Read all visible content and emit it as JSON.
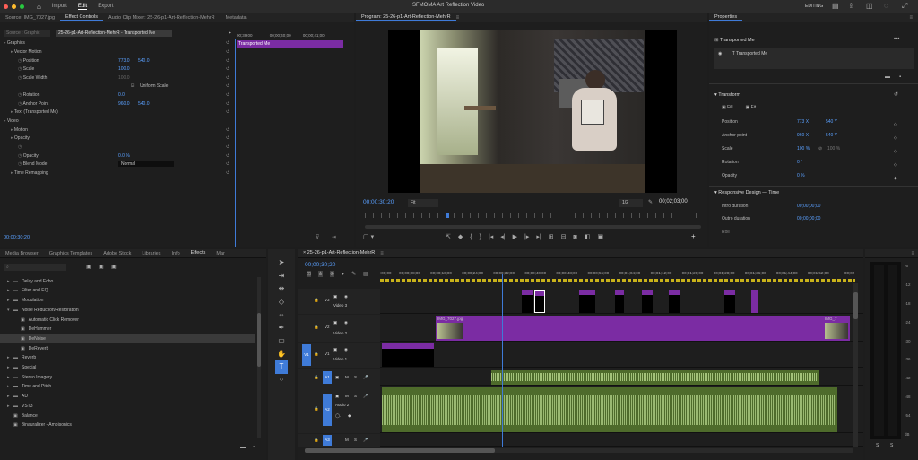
{
  "titlebar": {
    "home_label": "⌂",
    "tabs": [
      "Import",
      "Edit",
      "Export"
    ],
    "active_tab": "Edit",
    "title": "SFMOMA Art Reflection Video",
    "workspace": "EDITING"
  },
  "source_panel": {
    "tabs": [
      "Source: IMG_7027.jpg",
      "Effect Controls",
      "Audio Clip Mixer: 25-26-p1-Art-Reflection-MehrR",
      "Metadata"
    ],
    "active_tab": "Effect Controls",
    "source_select_left": "Source : Graphic",
    "source_select_right": "25-26-p1-Art-Reflection-MehrR - Transported Me",
    "ruler_labels": [
      "00;39;00",
      "00;00;40;00",
      "00;00;41;00"
    ],
    "clip_label": "Transported Me",
    "rows": [
      {
        "label": "Graphics",
        "indent": 0,
        "value": "",
        "value2": ""
      },
      {
        "label": "Vector Motion",
        "indent": 1,
        "value": "",
        "value2": ""
      },
      {
        "label": "Position",
        "indent": 2,
        "value": "773.0",
        "value2": "540.0"
      },
      {
        "label": "Scale",
        "indent": 2,
        "value": "100.0",
        "value2": ""
      },
      {
        "label": "Scale Width",
        "indent": 2,
        "value": "100.0",
        "value2": ""
      },
      {
        "label": "Uniform Scale",
        "indent": 3,
        "value": "",
        "value2": ""
      },
      {
        "label": "Rotation",
        "indent": 2,
        "value": "0.0",
        "value2": ""
      },
      {
        "label": "Anchor Point",
        "indent": 2,
        "value": "960.0",
        "value2": "540.0"
      },
      {
        "label": "Text (Transported Me)",
        "indent": 1,
        "value": "",
        "value2": ""
      },
      {
        "label": "Video",
        "indent": 0,
        "value": "",
        "value2": ""
      },
      {
        "label": "Motion",
        "indent": 1,
        "value": "",
        "value2": ""
      },
      {
        "label": "Opacity",
        "indent": 1,
        "value": "",
        "value2": ""
      },
      {
        "label": "",
        "indent": 2,
        "value": "",
        "value2": ""
      },
      {
        "label": "Opacity",
        "indent": 2,
        "value": "0.0 %",
        "value2": ""
      },
      {
        "label": "Blend Mode",
        "indent": 2,
        "value": "Normal",
        "value2": ""
      },
      {
        "label": "Time Remapping",
        "indent": 1,
        "value": "",
        "value2": ""
      }
    ],
    "timecode": "00;00;30;20"
  },
  "program": {
    "title": "Program: 25-26-p1-Art-Reflection-MehrR",
    "timecode": "00;00;30;20",
    "fit": "Fit",
    "quality": "1/2",
    "duration": "00;02;03;00"
  },
  "properties": {
    "title": "Properties",
    "clip_title": "Transported Me",
    "layer_name": "Transported Me",
    "transform_title": "Transform",
    "fill_label": "Fill",
    "fit_label": "Fit",
    "position": {
      "label": "Position",
      "x": "773 X",
      "y": "540 Y"
    },
    "anchor": {
      "label": "Anchor point",
      "x": "960 X",
      "y": "540 Y"
    },
    "scale": {
      "label": "Scale",
      "v1": "100 %",
      "v2": "100 %"
    },
    "rotation": {
      "label": "Rotation",
      "value": "0 °"
    },
    "opacity": {
      "label": "Opacity",
      "value": "0 %"
    },
    "responsive_title": "Responsive Design — Time",
    "intro": {
      "label": "Intro duration",
      "value": "00;00;00;00"
    },
    "outro": {
      "label": "Outro duration",
      "value": "00;00;00;00"
    },
    "roll": "Roll"
  },
  "effects_panel": {
    "tabs": [
      "Media Browser",
      "Graphics Templates",
      "Adobe Stock",
      "Libraries",
      "Info",
      "Effects",
      "Mar"
    ],
    "active_tab": "Effects",
    "items": [
      {
        "label": "Delay and Echo",
        "indent": 1,
        "type": "folder"
      },
      {
        "label": "Filter and EQ",
        "indent": 1,
        "type": "folder"
      },
      {
        "label": "Modulation",
        "indent": 1,
        "type": "folder"
      },
      {
        "label": "Noise Reduction/Restoration",
        "indent": 1,
        "type": "folder-open"
      },
      {
        "label": "Automatic Click Remover",
        "indent": 2,
        "type": "fx"
      },
      {
        "label": "DeHummer",
        "indent": 2,
        "type": "fx"
      },
      {
        "label": "DeNoise",
        "indent": 2,
        "type": "fx"
      },
      {
        "label": "DeReverb",
        "indent": 2,
        "type": "fx"
      },
      {
        "label": "Reverb",
        "indent": 1,
        "type": "folder"
      },
      {
        "label": "Special",
        "indent": 1,
        "type": "folder"
      },
      {
        "label": "Stereo Imagery",
        "indent": 1,
        "type": "folder"
      },
      {
        "label": "Time and Pitch",
        "indent": 1,
        "type": "folder"
      },
      {
        "label": "AU",
        "indent": 1,
        "type": "folder"
      },
      {
        "label": "VST3",
        "indent": 1,
        "type": "folder"
      },
      {
        "label": "Balance",
        "indent": 1,
        "type": "fx"
      },
      {
        "label": "Binauralizer - Ambisonics",
        "indent": 1,
        "type": "fx"
      }
    ],
    "selected": "DeNoise"
  },
  "timeline": {
    "sequence": "25-26-p1-Art-Reflection-MehrR",
    "timecode": "00;00;30;20",
    "ruler": [
      ":00;00",
      "00;00;08;00",
      "00;00;16;00",
      "00;00;24;00",
      "00;00;32;00",
      "00;00;40;00",
      "00;00;48;00",
      "00;00;56;00",
      "00;01;04;00",
      "00;01;12;00",
      "00;01;20;00",
      "00;01;28;00",
      "00;01;36;00",
      "00;01;44;00",
      "00;01;52;00",
      "00;02"
    ],
    "tracks": {
      "v3": "V3",
      "v3_name": "Video 3",
      "v2": "V2",
      "v2_name": "Video 2",
      "v1": "V1",
      "v1_name": "Video 1",
      "a1": "A1",
      "a2": "A2",
      "a2_name": "Audio 2",
      "a3": "A3",
      "a4": "A4"
    },
    "clip_img": "IMG_7027.jpg",
    "clip_img_end": "IMG_7"
  },
  "meter_scale": [
    "-6",
    "-12",
    "-18",
    "-24",
    "-30",
    "-36",
    "-42",
    "-48",
    "-54",
    "dB"
  ],
  "meter_labels": [
    "S",
    "S"
  ],
  "colors": {
    "purple": "#7b2ca3",
    "green": "#4e6b2b",
    "blue": "#3f7bd8",
    "accent": "#5aa0ff"
  }
}
